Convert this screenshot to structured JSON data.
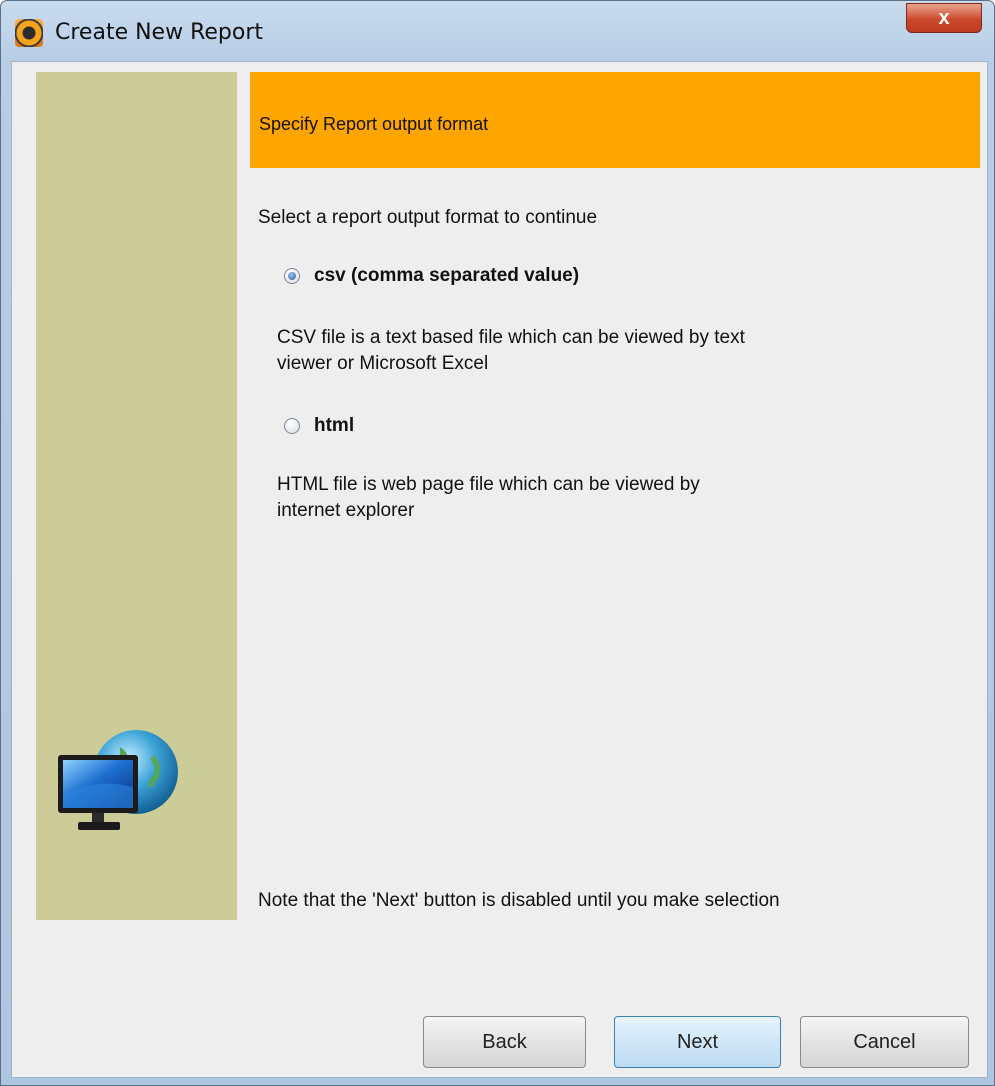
{
  "window": {
    "title": "Create New Report",
    "close_glyph": "x"
  },
  "header": {
    "title": "Specify Report output format"
  },
  "prompt": "Select a report output format to continue",
  "options": [
    {
      "label": "csv (comma separated value)",
      "selected": true,
      "desc_line1": "CSV file is a text based file which can be viewed by text",
      "desc_line2": "viewer or Microsoft Excel"
    },
    {
      "label": "html",
      "selected": false,
      "desc_line1": "HTML file is web page file which can be viewed by",
      "desc_line2": "internet explorer"
    }
  ],
  "note": "Note that the 'Next' button is disabled until you make selection",
  "buttons": {
    "back": "Back",
    "next": "Next",
    "cancel": "Cancel"
  },
  "colors": {
    "header_bg": "#ffa500",
    "side_panel": "#cccc99",
    "client_bg": "#eeeeee"
  },
  "icons": {
    "app": "report-app-icon",
    "side": "monitor-globe-icon"
  }
}
